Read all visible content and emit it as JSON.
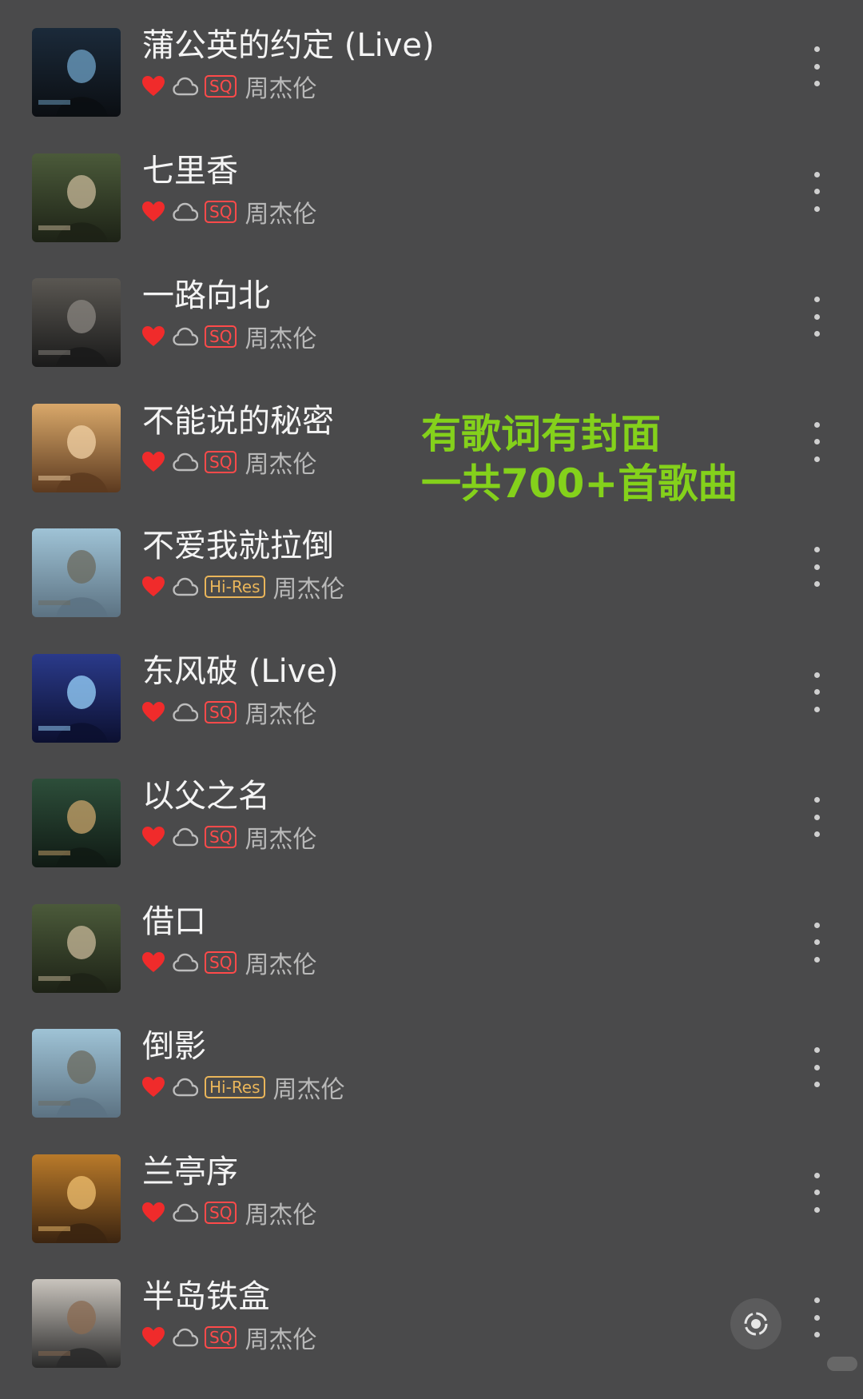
{
  "songs": [
    {
      "title": "蒲公英的约定 (Live)",
      "artist": "周杰伦",
      "quality": "SQ",
      "liked": true,
      "cover": {
        "bg1": "#1b2a3a",
        "bg2": "#0b0e12",
        "accent": "#6fa3c8"
      }
    },
    {
      "title": "七里香",
      "artist": "周杰伦",
      "quality": "SQ",
      "liked": true,
      "cover": {
        "bg1": "#4b5a3a",
        "bg2": "#1d2216",
        "accent": "#c8b89a"
      }
    },
    {
      "title": "一路向北",
      "artist": "周杰伦",
      "quality": "SQ",
      "liked": true,
      "cover": {
        "bg1": "#5a5752",
        "bg2": "#1a1a1a",
        "accent": "#8a8680"
      }
    },
    {
      "title": "不能说的秘密",
      "artist": "周杰伦",
      "quality": "SQ",
      "liked": true,
      "cover": {
        "bg1": "#d9a86a",
        "bg2": "#5c3a1f",
        "accent": "#f1d2a6"
      }
    },
    {
      "title": "不爱我就拉倒",
      "artist": "周杰伦",
      "quality": "Hi-Res",
      "liked": true,
      "cover": {
        "bg1": "#9fc3d6",
        "bg2": "#5c7282",
        "accent": "#6b6a5e"
      }
    },
    {
      "title": "东风破 (Live)",
      "artist": "周杰伦",
      "quality": "SQ",
      "liked": true,
      "cover": {
        "bg1": "#2a3a8a",
        "bg2": "#0c1030",
        "accent": "#9ad6ff"
      }
    },
    {
      "title": "以父之名",
      "artist": "周杰伦",
      "quality": "SQ",
      "liked": true,
      "cover": {
        "bg1": "#2d4e3a",
        "bg2": "#101a14",
        "accent": "#c9a46b"
      }
    },
    {
      "title": "借口",
      "artist": "周杰伦",
      "quality": "SQ",
      "liked": true,
      "cover": {
        "bg1": "#4b5a3a",
        "bg2": "#1d2216",
        "accent": "#c8b89a"
      }
    },
    {
      "title": "倒影",
      "artist": "周杰伦",
      "quality": "Hi-Res",
      "liked": true,
      "cover": {
        "bg1": "#9fc3d6",
        "bg2": "#5c7282",
        "accent": "#6b6a5e"
      }
    },
    {
      "title": "兰亭序",
      "artist": "周杰伦",
      "quality": "SQ",
      "liked": true,
      "cover": {
        "bg1": "#b97a2a",
        "bg2": "#3b2410",
        "accent": "#f0c070"
      }
    },
    {
      "title": "半岛铁盒",
      "artist": "周杰伦",
      "quality": "SQ",
      "liked": true,
      "cover": {
        "bg1": "#c9c4bd",
        "bg2": "#2a2a2a",
        "accent": "#8a6a50"
      }
    }
  ],
  "promo": {
    "line1": "有歌词有封面",
    "line2": "一共700+首歌曲"
  },
  "colors": {
    "background": "#4a4a4b",
    "heart": "#f02b2b",
    "sq": "#ff4a4a",
    "hires": "#e9b55a",
    "promo": "#84d11b"
  },
  "icons": {
    "like": "heart-icon",
    "cloud": "cloud-icon",
    "more": "more-vertical-icon",
    "floating": "locate-icon"
  }
}
